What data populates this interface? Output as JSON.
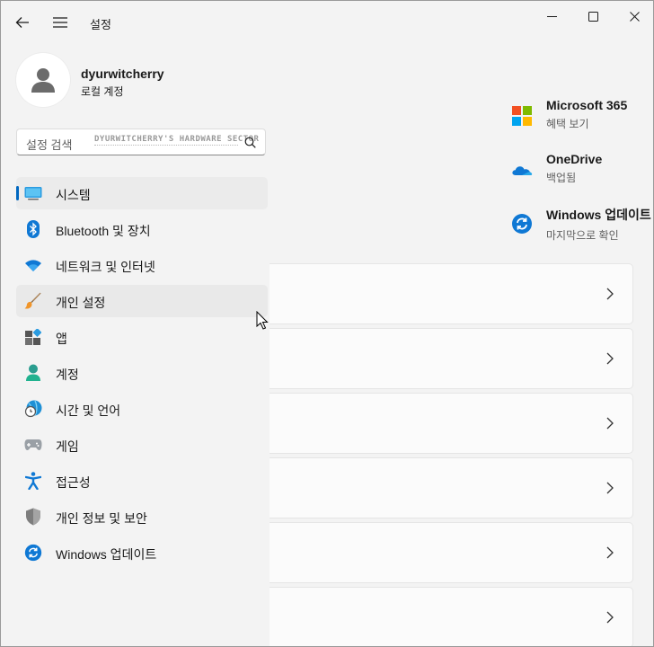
{
  "titlebar": {
    "title": "설정"
  },
  "profile": {
    "name": "dyurwitcherry",
    "account_type": "로컬 계정"
  },
  "search": {
    "placeholder": "설정 검색",
    "watermark": "DYURWITCHERRY'S HARDWARE SECTOR"
  },
  "nav": {
    "items": [
      {
        "label": "시스템",
        "icon": "monitor-icon",
        "selected": true
      },
      {
        "label": "Bluetooth 및 장치",
        "icon": "bluetooth-icon"
      },
      {
        "label": "네트워크 및 인터넷",
        "icon": "wifi-icon"
      },
      {
        "label": "개인 설정",
        "icon": "brush-icon",
        "hover": true
      },
      {
        "label": "앱",
        "icon": "apps-icon"
      },
      {
        "label": "계정",
        "icon": "person-icon"
      },
      {
        "label": "시간 및 언어",
        "icon": "globe-clock-icon"
      },
      {
        "label": "게임",
        "icon": "gamepad-icon"
      },
      {
        "label": "접근성",
        "icon": "accessibility-icon"
      },
      {
        "label": "개인 정보 및 보안",
        "icon": "shield-icon"
      },
      {
        "label": "Windows 업데이트",
        "icon": "update-icon"
      }
    ]
  },
  "services": [
    {
      "title": "Microsoft 365",
      "subtitle": "혜택 보기",
      "icon": "microsoft-logo-icon"
    },
    {
      "title": "OneDrive",
      "subtitle": "백업됨",
      "icon": "onedrive-icon"
    },
    {
      "title": "Windows 업데이트",
      "subtitle": "마지막으로 확인",
      "icon": "update-icon"
    }
  ],
  "colors": {
    "accent": "#0067c0",
    "background": "#f3f3f3",
    "card": "#fbfbfb"
  }
}
